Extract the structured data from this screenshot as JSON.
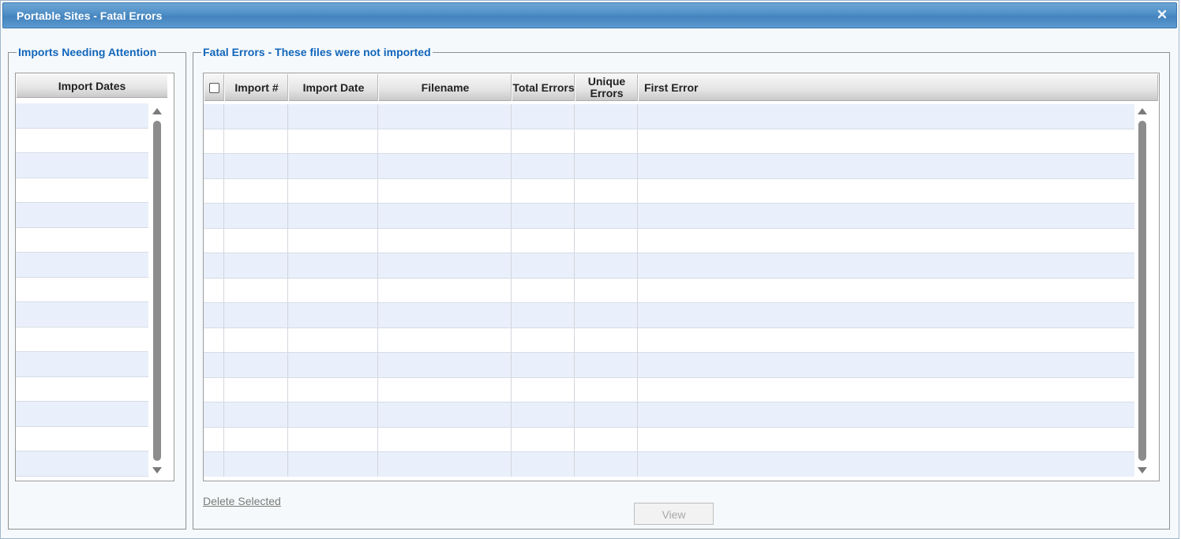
{
  "window": {
    "title": "Portable Sites - Fatal Errors",
    "close_icon": "close-icon"
  },
  "left_panel": {
    "legend": "Imports Needing Attention",
    "grid": {
      "header": "Import Dates",
      "rows": [
        "",
        "",
        "",
        "",
        "",
        "",
        "",
        "",
        "",
        "",
        "",
        "",
        "",
        "",
        ""
      ]
    }
  },
  "right_panel": {
    "legend": "Fatal Errors - These files were not imported",
    "grid": {
      "columns": [
        {
          "key": "select",
          "label": ""
        },
        {
          "key": "import_num",
          "label": "Import #"
        },
        {
          "key": "import_date",
          "label": "Import Date"
        },
        {
          "key": "filename",
          "label": "Filename"
        },
        {
          "key": "total_errors",
          "label": "Total Errors"
        },
        {
          "key": "unique_errors",
          "label": "Unique Errors"
        },
        {
          "key": "first_error",
          "label": "First Error"
        }
      ],
      "rows": []
    }
  },
  "actions": {
    "delete_selected": "Delete Selected",
    "view": "View"
  },
  "colors": {
    "titlebar": "#4f8fc7",
    "legend_text": "#1166bb",
    "row_alt": "#e9f0fb"
  }
}
